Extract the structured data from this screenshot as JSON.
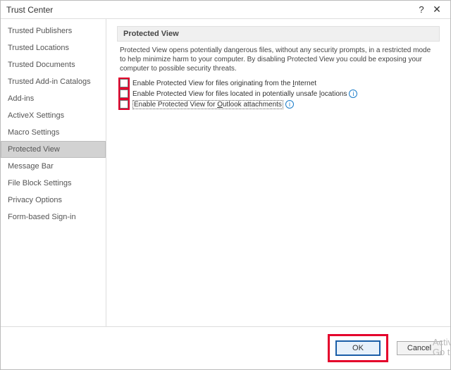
{
  "window": {
    "title": "Trust Center"
  },
  "sidebar": {
    "items": [
      {
        "label": "Trusted Publishers"
      },
      {
        "label": "Trusted Locations"
      },
      {
        "label": "Trusted Documents"
      },
      {
        "label": "Trusted Add-in Catalogs"
      },
      {
        "label": "Add-ins"
      },
      {
        "label": "ActiveX Settings"
      },
      {
        "label": "Macro Settings"
      },
      {
        "label": "Protected View",
        "selected": true
      },
      {
        "label": "Message Bar"
      },
      {
        "label": "File Block Settings"
      },
      {
        "label": "Privacy Options"
      },
      {
        "label": "Form-based Sign-in"
      }
    ]
  },
  "panel": {
    "heading": "Protected View",
    "description": "Protected View opens potentially dangerous files, without any security prompts, in a restricted mode to help minimize harm to your computer. By disabling Protected View you could be exposing your computer to possible security threats.",
    "options": [
      {
        "label_pre": "Enable Protected View for files originating from the ",
        "underline": "I",
        "label_post": "nternet",
        "checked": false,
        "info": false
      },
      {
        "label_pre": "Enable Protected View for files located in potentially unsafe ",
        "underline": "l",
        "label_post": "ocations",
        "checked": false,
        "info": true
      },
      {
        "label_pre": "Enable Protected View for ",
        "underline": "O",
        "label_post": "utlook attachments",
        "checked": false,
        "info": true,
        "focused": true
      }
    ]
  },
  "buttons": {
    "ok": "OK",
    "cancel": "Cancel"
  },
  "watermark": {
    "line1": "Activ",
    "line2": "Go t"
  }
}
